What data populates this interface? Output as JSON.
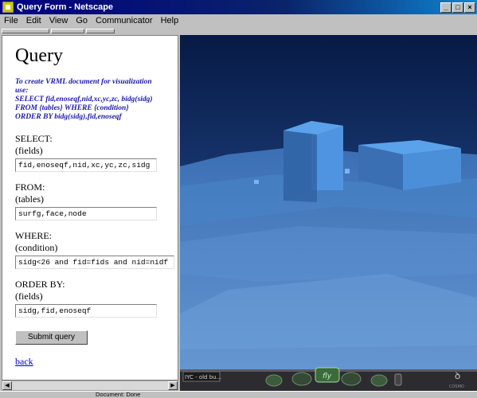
{
  "window": {
    "title": "Query Form - Netscape",
    "minimize_glyph": "_",
    "maximize_glyph": "□",
    "close_glyph": "×"
  },
  "menu": [
    {
      "label": "File"
    },
    {
      "label": "Edit"
    },
    {
      "label": "View"
    },
    {
      "label": "Go"
    },
    {
      "label": "Communicator"
    },
    {
      "label": "Help"
    }
  ],
  "page": {
    "heading": "Query",
    "info_lines": [
      "To create VRML document for visualization",
      "use:",
      "SELECT fid,enoseqf,nid,xc,yc,zc, bidg(sidg)",
      "FROM {tables} WHERE {condition}",
      "ORDER BY bidg(sidg),fid,enoseqf"
    ],
    "select": {
      "label": "SELECT:",
      "sub": "(fields)",
      "value": "fid,enoseqf,nid,xc,yc,zc,sidg"
    },
    "from": {
      "label": "FROM:",
      "sub": "(tables)",
      "value": "surfg,face,node"
    },
    "where": {
      "label": "WHERE:",
      "sub": "(condition)",
      "value": "sidg<26 and fid=fids and nid=nidf"
    },
    "orderby": {
      "label": "ORDER BY:",
      "sub": "(fields)",
      "value": "sidg,fid,enoseqf"
    },
    "submit_label": "Submit query",
    "back_label": "back"
  },
  "viewer": {
    "label": "IYC - old bu...",
    "sky_color": "#1f3a6e",
    "ground_color": "#3a73b8",
    "building_color": "#4a8fd8",
    "nav_icons": [
      "move-icon",
      "walk-icon",
      "fly-icon",
      "slide-icon",
      "tilt-icon",
      "pan-icon"
    ],
    "fly_label": "fly",
    "brand": "COSMO"
  },
  "status": {
    "text": "Document: Done"
  }
}
